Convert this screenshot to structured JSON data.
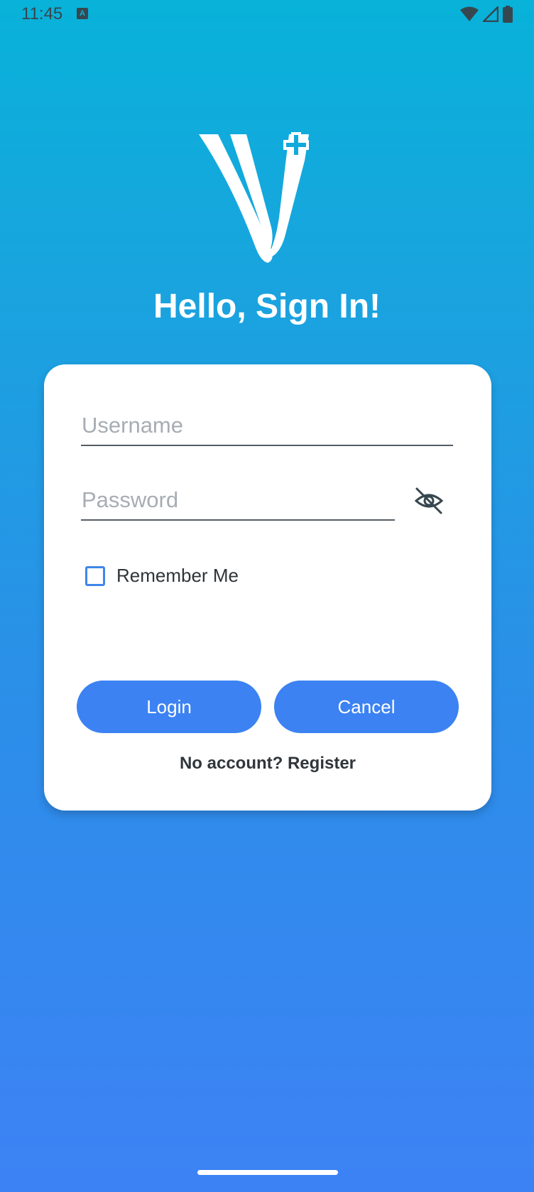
{
  "status_bar": {
    "time": "11:45",
    "notification_glyph": "A",
    "icons": [
      "wifi-icon",
      "cell-signal-icon",
      "battery-icon"
    ]
  },
  "logo": {
    "icon": "v-cross-logo"
  },
  "headline": "Hello, Sign In!",
  "form": {
    "username_placeholder": "Username",
    "username_value": "",
    "password_placeholder": "Password",
    "password_value": "",
    "password_visibility_icon": "eye-off-icon",
    "remember_me_label": "Remember Me",
    "remember_me_checked": false,
    "login_label": "Login",
    "cancel_label": "Cancel",
    "register_text": "No account? Register"
  },
  "colors": {
    "gradient_top": "#08b2d9",
    "gradient_bottom": "#3d82f5",
    "button": "#3c82f2",
    "checkbox_border": "#3f86ea"
  }
}
